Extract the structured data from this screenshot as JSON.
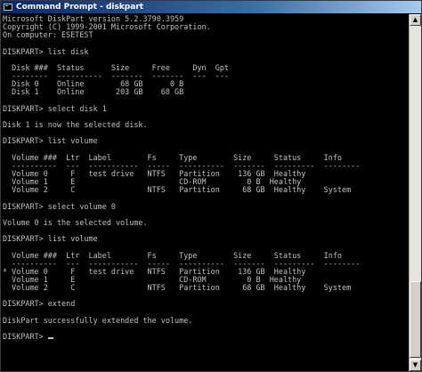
{
  "window": {
    "title": "Command Prompt - diskpart"
  },
  "console": {
    "lines": [
      "Microsoft DiskPart version 5.2.3790.3959",
      "Copyright (C) 1999-2001 Microsoft Corporation.",
      "On computer: ESETEST",
      "",
      "DISKPART> list disk",
      "",
      "  Disk ###  Status      Size     Free     Dyn  Gpt",
      "  --------  ----------  -------  -------  ---  ---",
      "  Disk 0    Online        68 GB      0 B",
      "  Disk 1    Online       203 GB    68 GB",
      "",
      "DISKPART> select disk 1",
      "",
      "Disk 1 is now the selected disk.",
      "",
      "DISKPART> list volume",
      "",
      "  Volume ###  Ltr  Label        Fs     Type        Size     Status     Info",
      "  ----------  ---  -----------  -----  ----------  -------  ---------  --------",
      "  Volume 0     F   test drive   NTFS   Partition    136 GB  Healthy",
      "  Volume 1     E                       CD-ROM         0 B  Healthy",
      "  Volume 2     C                NTFS   Partition     68 GB  Healthy    System",
      "",
      "DISKPART> select volume 0",
      "",
      "Volume 0 is the selected volume.",
      "",
      "DISKPART> list volume",
      "",
      "  Volume ###  Ltr  Label        Fs     Type        Size     Status     Info",
      "  ----------  ---  -----------  -----  ----------  -------  ---------  --------",
      "* Volume 0     F   test drive   NTFS   Partition    136 GB  Healthy",
      "  Volume 1     E                       CD-ROM         0 B  Healthy",
      "  Volume 2     C                NTFS   Partition     68 GB  Healthy    System",
      "",
      "DISKPART> extend",
      "",
      "DiskPart successfully extended the volume.",
      "",
      "DISKPART> "
    ]
  }
}
